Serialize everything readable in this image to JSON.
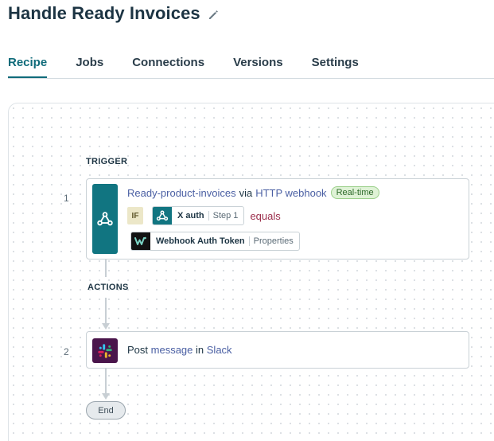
{
  "recipe": {
    "title": "Handle Ready Invoices"
  },
  "tabs": [
    {
      "label": "Recipe",
      "active": true
    },
    {
      "label": "Jobs",
      "active": false
    },
    {
      "label": "Connections",
      "active": false
    },
    {
      "label": "Versions",
      "active": false
    },
    {
      "label": "Settings",
      "active": false
    }
  ],
  "trigger": {
    "section_label": "TRIGGER",
    "step_number": "1",
    "event": "Ready-product-invoices",
    "via": "via",
    "app": "HTTP webhook",
    "badge": "Real-time",
    "condition": {
      "if_label": "IF",
      "field": "X auth",
      "field_step": "Step 1",
      "operator": "equals",
      "value_label": "Webhook Auth Token",
      "value_source": "Properties"
    }
  },
  "actions": {
    "section_label": "ACTIONS",
    "items": [
      {
        "step_number": "2",
        "verb": "Post",
        "object": "message",
        "preposition": "in",
        "app": "Slack"
      }
    ]
  },
  "end_label": "End",
  "colors": {
    "accent": "#0f6b7a",
    "webhook_app": "#117581",
    "slack_app": "#4a154b",
    "operator": "#9b2d4b",
    "link": "#4a5fa3"
  },
  "icons": {
    "edit": "pencil-icon",
    "webhook": "webhook-icon",
    "slack": "slack-icon",
    "workato": "workato-icon"
  }
}
